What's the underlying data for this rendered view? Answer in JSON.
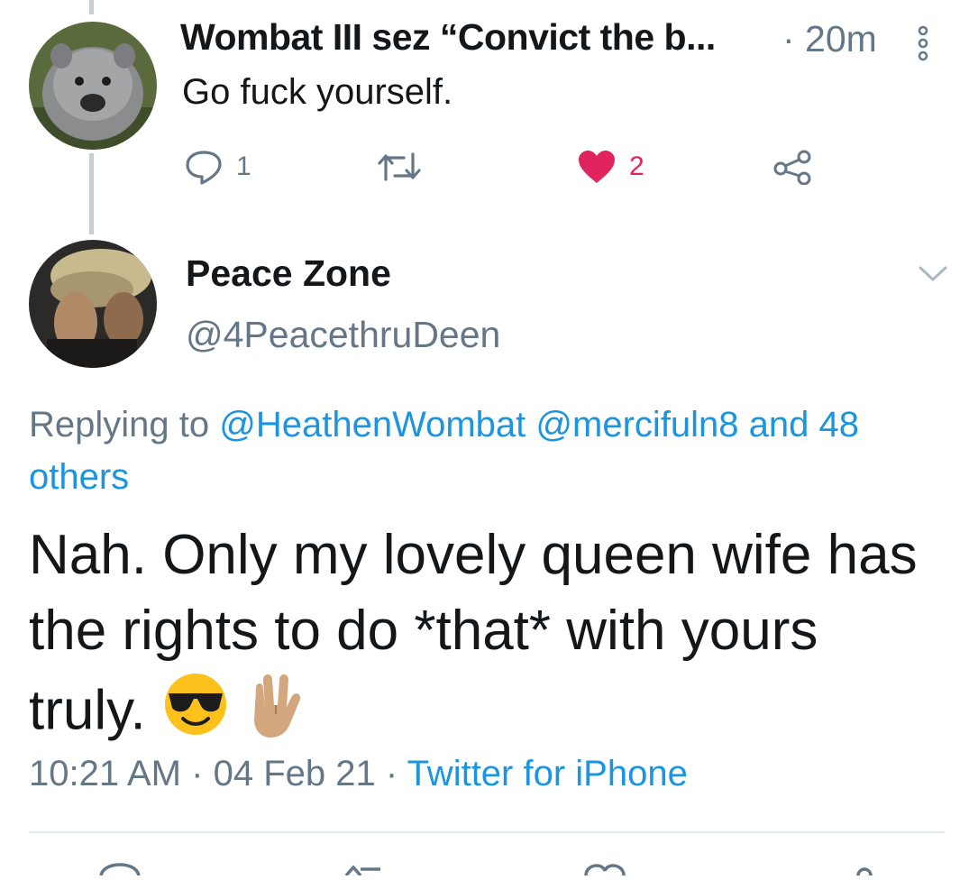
{
  "reply_tweet": {
    "author_name": "Wombat III sez “Convict the b...",
    "time": "· 20m",
    "text": "Go fuck yourself.",
    "actions": {
      "reply_count": "1",
      "retweet_count": "",
      "like_count": "2",
      "share": ""
    },
    "avatar_icon": "wombat-photo"
  },
  "main_tweet": {
    "author_name": "Peace Zone",
    "handle": "@4PeacethruDeen",
    "replying_prefix": "Replying to",
    "replying_users": [
      "@HeathenWombat",
      "@mercifuln8"
    ],
    "replying_and": "and",
    "replying_others": "48 others",
    "text": "Nah. Only my lovely queen wife has the rights to do *that* with yours truly.",
    "emojis": [
      "smiling-face-with-sunglasses",
      "vulcan-salute"
    ],
    "timestamp": "10:21 AM",
    "date": "04 Feb 21",
    "source": "Twitter for iPhone",
    "sep": "·"
  },
  "colors": {
    "accent": "#1b95e0",
    "like": "#e0245e",
    "muted": "#657786",
    "thread_line": "#c4cfd6"
  }
}
